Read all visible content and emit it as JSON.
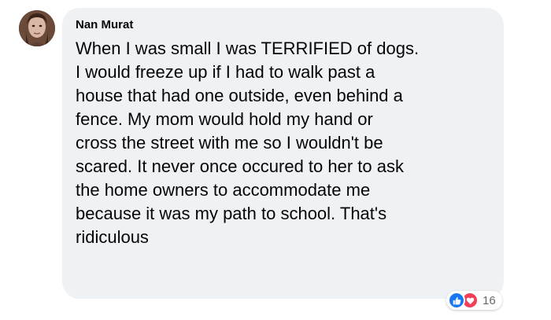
{
  "comment": {
    "author": "Nan Murat",
    "text": "When I was small I was TERRIFIED of dogs.\nI would freeze up if I had to walk past a\nhouse that had one outside, even behind a\nfence. My mom would hold my hand or\ncross the street with me so I wouldn't be\nscared. It never once occured to her to ask\nthe home owners to accommodate me\nbecause it was my path to school. That's\nridiculous"
  },
  "reactions": {
    "icons": [
      "like-icon",
      "love-icon"
    ],
    "count": "16"
  },
  "colors": {
    "bubble": "#eff2f5",
    "like": "#1877f2",
    "love": "#f33e58",
    "count_text": "#65676b"
  }
}
